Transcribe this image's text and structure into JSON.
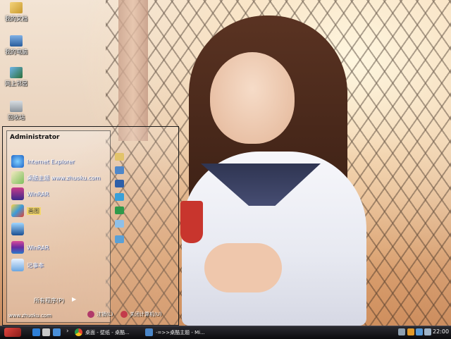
{
  "desktop_icons": [
    {
      "label": "我的文档",
      "icon": "my-documents-icon"
    },
    {
      "label": "我的电脑",
      "icon": "my-computer-icon"
    },
    {
      "label": "网上邻居",
      "icon": "network-places-icon"
    },
    {
      "label": "回收站",
      "icon": "recycle-bin-icon"
    }
  ],
  "start_menu": {
    "user": "Administrator",
    "items": [
      {
        "label": "Internet Explorer",
        "icon": "internet-explorer-icon"
      },
      {
        "label": "桌酷主题 www.zhuoku.com",
        "icon": "zhuoku-theme-icon"
      },
      {
        "label": "WinRAR",
        "icon": "winrar-icon"
      },
      {
        "label": "画图",
        "icon": "paint-icon"
      },
      {
        "label": "",
        "icon": "monitor-icon"
      },
      {
        "label": "WinRAR",
        "icon": "winrar-archive-icon"
      },
      {
        "label": "记事本",
        "icon": "notepad-icon"
      }
    ],
    "all_programs": "所有程序(P)",
    "site": "www.zhuoku.com",
    "logoff": "注销(L)",
    "shutdown": "关闭计算机(U)"
  },
  "taskbar": {
    "tasks": [
      {
        "label": "桌面 - 壁纸 - 桌酷...",
        "icon": "chrome-icon"
      },
      {
        "label": "-=>>桌酷主题 - Mi...",
        "icon": "document-window-icon"
      }
    ],
    "clock": "22:00"
  },
  "colors": {
    "taskbar": "#0b0b0e",
    "accent": "#e0453f"
  }
}
